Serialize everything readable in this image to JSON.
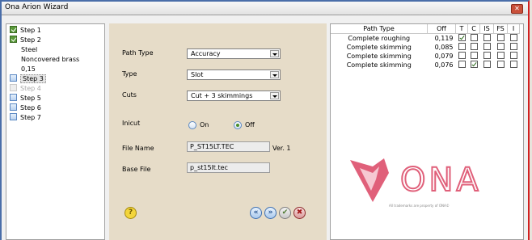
{
  "window": {
    "title": "Ona Arion Wizard"
  },
  "tree": {
    "items": [
      {
        "label": "Step 1",
        "state": "done"
      },
      {
        "label": "Step 2",
        "state": "done"
      },
      {
        "label": "Steel",
        "state": "child"
      },
      {
        "label": "Noncovered brass",
        "state": "child"
      },
      {
        "label": "0,15",
        "state": "child"
      },
      {
        "label": "Step 3",
        "state": "current"
      },
      {
        "label": "Step 4",
        "state": "disabled"
      },
      {
        "label": "Step 5",
        "state": "open"
      },
      {
        "label": "Step 6",
        "state": "open"
      },
      {
        "label": "Step 7",
        "state": "open"
      }
    ]
  },
  "form": {
    "path_type": {
      "label": "Path Type",
      "value": "Accuracy"
    },
    "type": {
      "label": "Type",
      "value": "Slot"
    },
    "cuts": {
      "label": "Cuts",
      "value": "Cut + 3 skimmings"
    },
    "inicut": {
      "label": "Inicut",
      "on_label": "On",
      "off_label": "Off",
      "selected": "Off"
    },
    "file_name": {
      "label": "File Name",
      "value": "P_ST15LT.TEC",
      "version": "Ver. 1"
    },
    "base_file": {
      "label": "Base File",
      "value": "p_st15lt.tec"
    },
    "buttons": {
      "help": "?",
      "back": "«",
      "next": "»",
      "finish": "✔",
      "cancel": "✖"
    }
  },
  "cuts_table": {
    "headers": [
      "Path Type",
      "Off",
      "T",
      "C",
      "IS",
      "FS",
      "I"
    ],
    "rows": [
      {
        "path": "Complete roughing",
        "off": "0,119",
        "T": true,
        "C": false,
        "IS": false,
        "FS": false,
        "I": false
      },
      {
        "path": "Complete skimming",
        "off": "0,085",
        "T": false,
        "C": false,
        "IS": false,
        "FS": false,
        "I": false
      },
      {
        "path": "Complete skimming",
        "off": "0,079",
        "T": false,
        "C": false,
        "IS": false,
        "FS": false,
        "I": false
      },
      {
        "path": "Complete skimming",
        "off": "0,076",
        "T": false,
        "C": true,
        "IS": false,
        "FS": false,
        "I": false
      }
    ]
  },
  "branding": {
    "logo_text": "ONA",
    "trademark": "All trademarks are property of ONA©",
    "logo_color": "#e0607a"
  }
}
